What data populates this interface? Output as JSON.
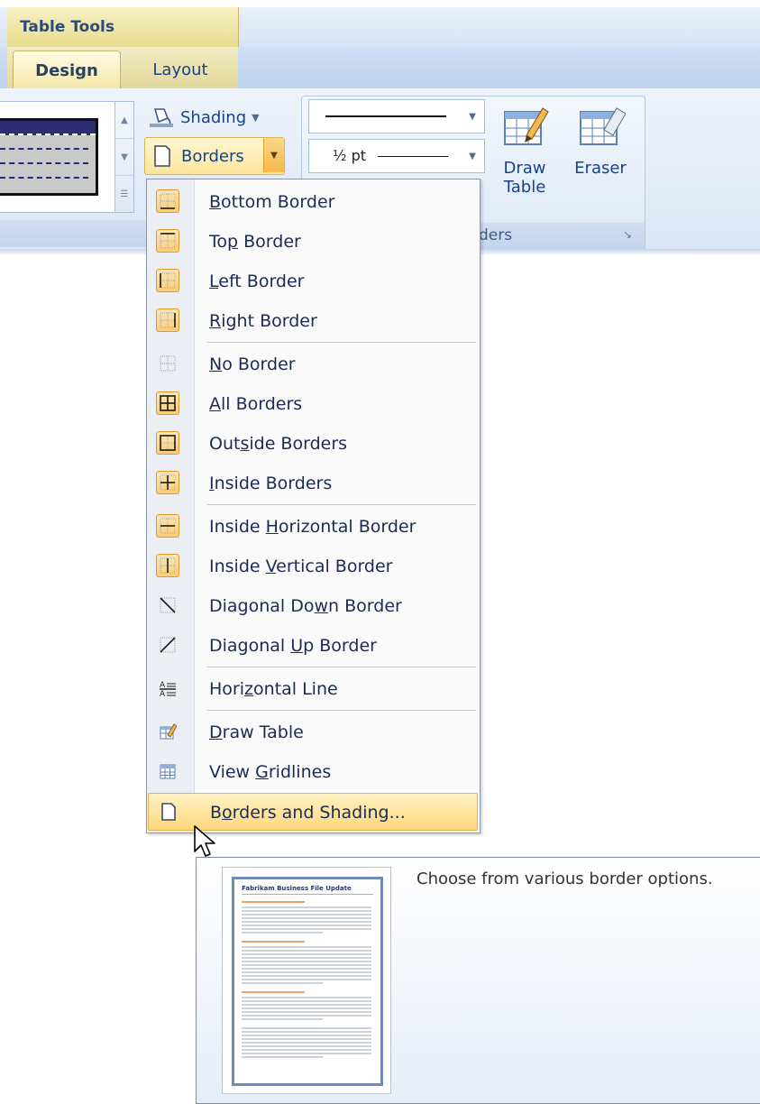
{
  "ribbon": {
    "context_tab": "Table Tools",
    "tabs": [
      "Design",
      "Layout"
    ],
    "shading_label": "Shading",
    "borders_label": "Borders",
    "line_weight": "½ pt",
    "draw_table_label": "Draw Table",
    "eraser_label": "Eraser",
    "group_label": "ders"
  },
  "menu": {
    "items": [
      {
        "pre": "",
        "ul": "B",
        "post": "ottom Border",
        "icon": "bottom-border-icon",
        "highlighted": true
      },
      {
        "pre": "To",
        "ul": "p",
        "post": " Border",
        "icon": "top-border-icon",
        "highlighted": true
      },
      {
        "pre": "",
        "ul": "L",
        "post": "eft Border",
        "icon": "left-border-icon",
        "highlighted": true
      },
      {
        "pre": "",
        "ul": "R",
        "post": "ight Border",
        "icon": "right-border-icon",
        "highlighted": true
      },
      {
        "pre": "",
        "ul": "N",
        "post": "o Border",
        "icon": "no-border-icon",
        "highlighted": false
      },
      {
        "pre": "",
        "ul": "A",
        "post": "ll Borders",
        "icon": "all-borders-icon",
        "highlighted": true
      },
      {
        "pre": "Out",
        "ul": "s",
        "post": "ide Borders",
        "icon": "outside-borders-icon",
        "highlighted": true
      },
      {
        "pre": "",
        "ul": "I",
        "post": "nside Borders",
        "icon": "inside-borders-icon",
        "highlighted": true
      },
      {
        "pre": "Inside ",
        "ul": "H",
        "post": "orizontal Border",
        "icon": "inside-horizontal-border-icon",
        "highlighted": true
      },
      {
        "pre": "Inside ",
        "ul": "V",
        "post": "ertical Border",
        "icon": "inside-vertical-border-icon",
        "highlighted": true
      },
      {
        "pre": "Diagonal Do",
        "ul": "w",
        "post": "n Border",
        "icon": "diagonal-down-border-icon",
        "highlighted": false
      },
      {
        "pre": "Diagonal ",
        "ul": "U",
        "post": "p Border",
        "icon": "diagonal-up-border-icon",
        "highlighted": false
      },
      {
        "pre": "Hori",
        "ul": "z",
        "post": "ontal Line",
        "icon": "horizontal-line-icon",
        "highlighted": false
      },
      {
        "pre": "",
        "ul": "D",
        "post": "raw Table",
        "icon": "draw-table-icon",
        "highlighted": false
      },
      {
        "pre": "View ",
        "ul": "G",
        "post": "ridlines",
        "icon": "view-gridlines-icon",
        "highlighted": false
      },
      {
        "pre": "B",
        "ul": "o",
        "post": "rders and Shading...",
        "icon": "borders-and-shading-icon",
        "highlighted": false
      }
    ]
  },
  "tooltip": {
    "description": "Choose from various border options.",
    "preview_title": "Fabrikam Business File Update"
  }
}
